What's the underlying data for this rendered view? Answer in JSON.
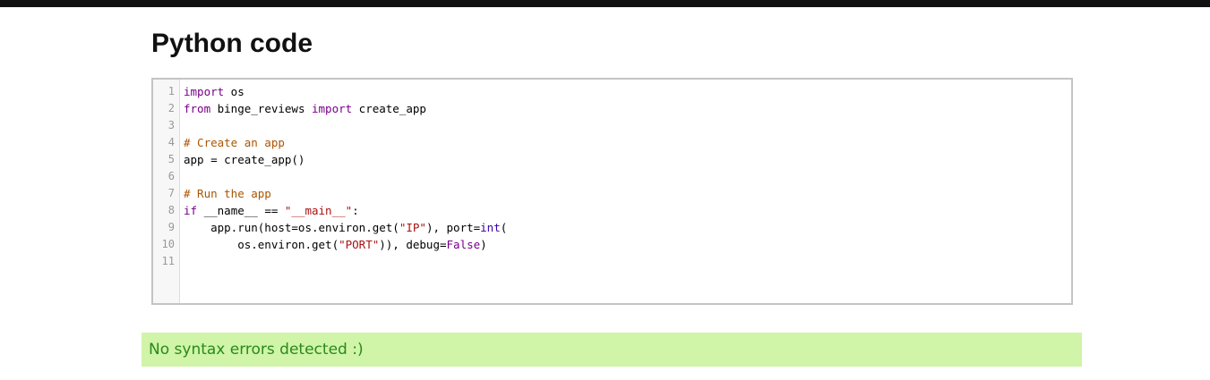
{
  "page": {
    "title": "Python code"
  },
  "editor": {
    "line_numbers": [
      "1",
      "2",
      "3",
      "4",
      "5",
      "6",
      "7",
      "8",
      "9",
      "10",
      "11"
    ],
    "lines": [
      [
        {
          "t": "keyword",
          "v": "import"
        },
        {
          "t": "plain",
          "v": " os"
        }
      ],
      [
        {
          "t": "keyword",
          "v": "from"
        },
        {
          "t": "plain",
          "v": " binge_reviews "
        },
        {
          "t": "keyword",
          "v": "import"
        },
        {
          "t": "plain",
          "v": " create_app"
        }
      ],
      [],
      [
        {
          "t": "comment",
          "v": "# Create an app"
        }
      ],
      [
        {
          "t": "plain",
          "v": "app = create_app()"
        }
      ],
      [],
      [
        {
          "t": "comment",
          "v": "# Run the app"
        }
      ],
      [
        {
          "t": "keyword",
          "v": "if"
        },
        {
          "t": "plain",
          "v": " __name__ == "
        },
        {
          "t": "string",
          "v": "\"__main__\""
        },
        {
          "t": "plain",
          "v": ":"
        }
      ],
      [
        {
          "t": "plain",
          "v": "    app.run(host=os.environ.get("
        },
        {
          "t": "string",
          "v": "\"IP\""
        },
        {
          "t": "plain",
          "v": "), port="
        },
        {
          "t": "builtin",
          "v": "int"
        },
        {
          "t": "plain",
          "v": "("
        }
      ],
      [
        {
          "t": "plain",
          "v": "        os.environ.get("
        },
        {
          "t": "string",
          "v": "\"PORT\""
        },
        {
          "t": "plain",
          "v": ")), debug="
        },
        {
          "t": "keyword",
          "v": "False"
        },
        {
          "t": "plain",
          "v": ")"
        }
      ],
      []
    ]
  },
  "status": {
    "message": "No syntax errors detected :)"
  },
  "colors": {
    "keyword": "#770088",
    "comment": "#aa5500",
    "string": "#aa1111",
    "builtin": "#3300aa",
    "status_bg": "#d0f4a8",
    "status_text": "#2a8a1a"
  }
}
